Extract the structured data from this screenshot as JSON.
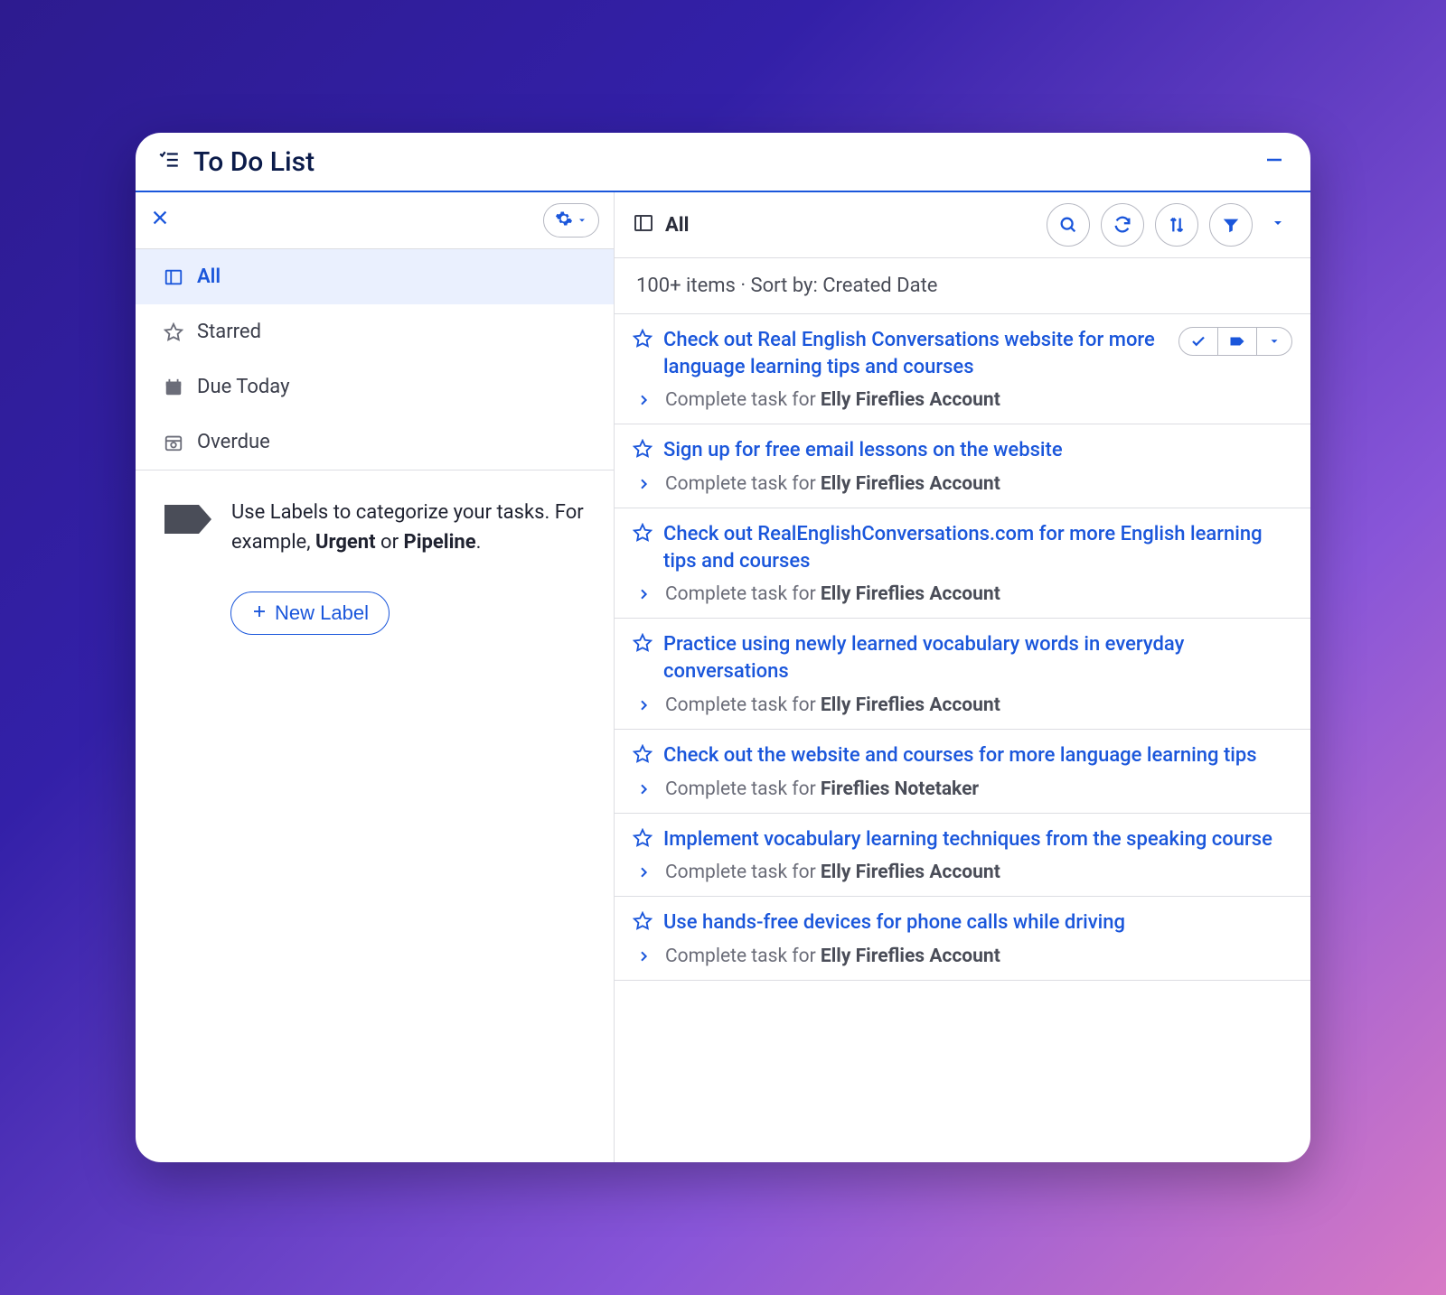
{
  "header": {
    "title": "To Do List"
  },
  "sidebar": {
    "nav": [
      {
        "label": "All",
        "active": true
      },
      {
        "label": "Starred",
        "active": false
      },
      {
        "label": "Due Today",
        "active": false
      },
      {
        "label": "Overdue",
        "active": false
      }
    ],
    "labels_hint_prefix": "Use Labels to categorize your tasks. For example, ",
    "labels_hint_b1": "Urgent",
    "labels_hint_mid": " or ",
    "labels_hint_b2": "Pipeline",
    "labels_hint_suffix": ".",
    "new_label_btn": "New Label"
  },
  "main": {
    "view_title": "All",
    "meta": "100+ items · Sort by: Created Date",
    "task_prefix": "Complete task for ",
    "tasks": [
      {
        "title": "Check out Real English Conversations website for more language learning tips and courses",
        "account": "Elly Fireflies Account",
        "show_actions": true
      },
      {
        "title": "Sign up for free email lessons on the website",
        "account": "Elly Fireflies Account",
        "show_actions": false
      },
      {
        "title": "Check out RealEnglishConversations.com for more English learning tips and courses",
        "account": "Elly Fireflies Account",
        "show_actions": false
      },
      {
        "title": "Practice using newly learned vocabulary words in everyday conversations",
        "account": "Elly Fireflies Account",
        "show_actions": false
      },
      {
        "title": "Check out the website and courses for more language learning tips",
        "account": "Fireflies Notetaker",
        "show_actions": false
      },
      {
        "title": "Implement vocabulary learning techniques from the speaking course",
        "account": "Elly Fireflies Account",
        "show_actions": false
      },
      {
        "title": "Use hands-free devices for phone calls while driving",
        "account": "Elly Fireflies Account",
        "show_actions": false
      }
    ]
  }
}
